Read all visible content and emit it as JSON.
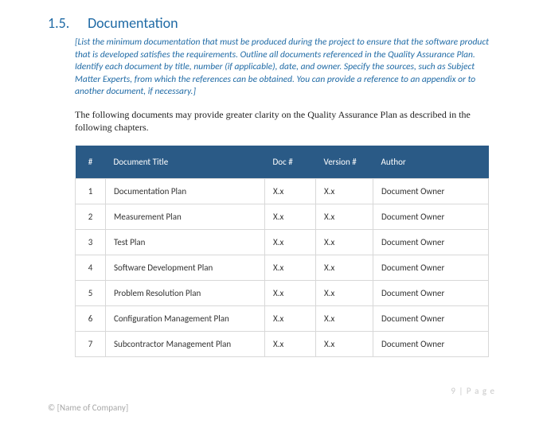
{
  "section": {
    "number": "1.5.",
    "title": "Documentation"
  },
  "instruction": "[List the minimum documentation that must be produced during the project to ensure that the software product that is developed satisfies the requirements. Outline all documents referenced in the Quality Assurance Plan. Identify each document by title, number (if applicable), date, and owner. Specify the sources, such as Subject Matter Experts, from which the references can be obtained. You can provide a reference to an appendix or to another document, if necessary.]",
  "intro": "The following documents may provide greater clarity on the Quality Assurance Plan as described in the following chapters.",
  "table": {
    "headers": {
      "num": "#",
      "title": "Document Title",
      "doc": "Doc #",
      "version": "Version #",
      "author": "Author"
    },
    "rows": [
      {
        "num": "1",
        "title": "Documentation Plan",
        "doc": "X.x",
        "version": "X.x",
        "author": "Document Owner"
      },
      {
        "num": "2",
        "title": "Measurement Plan",
        "doc": "X.x",
        "version": "X.x",
        "author": "Document Owner"
      },
      {
        "num": "3",
        "title": "Test Plan",
        "doc": "X.x",
        "version": "X.x",
        "author": "Document Owner"
      },
      {
        "num": "4",
        "title": "Software Development Plan",
        "doc": "X.x",
        "version": "X.x",
        "author": "Document Owner"
      },
      {
        "num": "5",
        "title": "Problem Resolution Plan",
        "doc": "X.x",
        "version": "X.x",
        "author": "Document Owner"
      },
      {
        "num": "6",
        "title": "Configuration Management Plan",
        "doc": "X.x",
        "version": "X.x",
        "author": "Document Owner"
      },
      {
        "num": "7",
        "title": "Subcontractor Management Plan",
        "doc": "X.x",
        "version": "X.x",
        "author": "Document Owner"
      }
    ]
  },
  "footer": {
    "page": "9 | P a g e",
    "copyright": "© [Name of Company]"
  }
}
